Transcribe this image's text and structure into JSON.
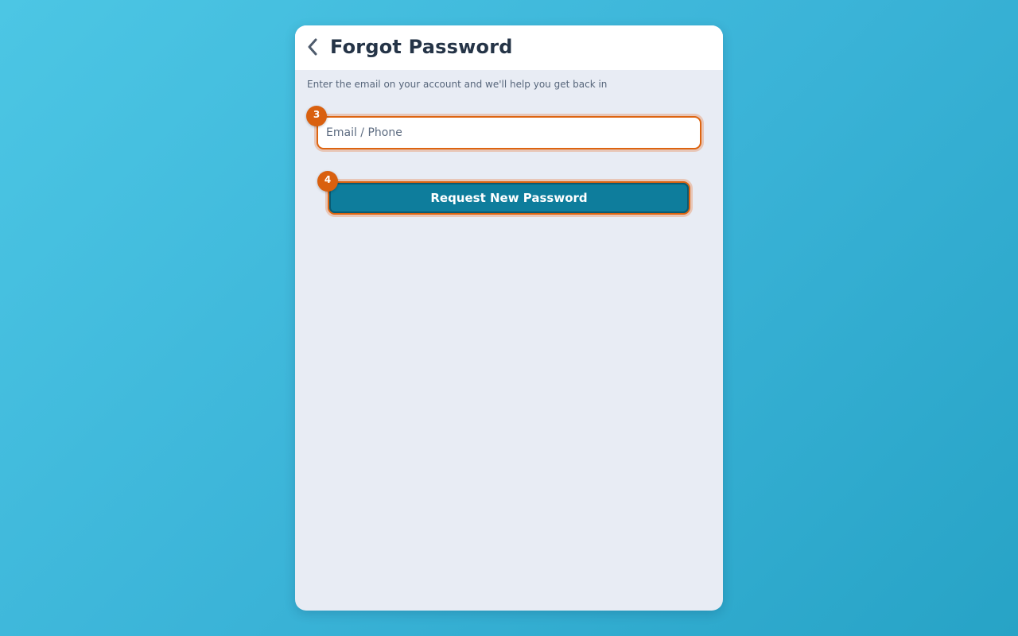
{
  "header": {
    "title": "Forgot Password",
    "back_icon": "chevron-left-icon"
  },
  "subtitle": "Enter the email on your account and we'll help you get back in",
  "form": {
    "email_placeholder": "Email / Phone",
    "email_value": "",
    "submit_label": "Request New Password"
  },
  "badges": {
    "input_badge": "3",
    "button_badge": "4"
  },
  "colors": {
    "accent_orange": "#dd6410",
    "button_teal": "#0e7d9c",
    "card_bg": "#e8ecf4",
    "title_color": "#253447"
  }
}
